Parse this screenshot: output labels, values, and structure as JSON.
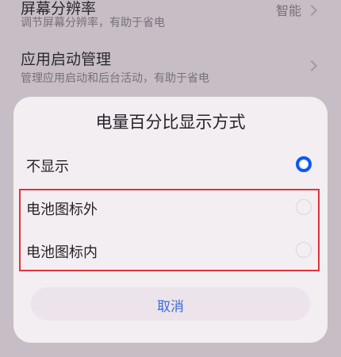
{
  "background_settings": [
    {
      "title": "屏幕分辨率",
      "desc": "调节屏幕分辨率，有助于省电",
      "value": "智能"
    },
    {
      "title": "应用启动管理",
      "desc": "管理应用启动和后台活动，有助于省电",
      "value": ""
    }
  ],
  "dialog": {
    "title": "电量百分比显示方式",
    "options": [
      {
        "label": "不显示",
        "selected": true
      },
      {
        "label": "电池图标外",
        "selected": false
      },
      {
        "label": "电池图标内",
        "selected": false
      }
    ],
    "cancel_label": "取消"
  },
  "colors": {
    "accent": "#0a59f7",
    "highlight": "#e0343a",
    "cancel_text": "#3b6bd6"
  }
}
